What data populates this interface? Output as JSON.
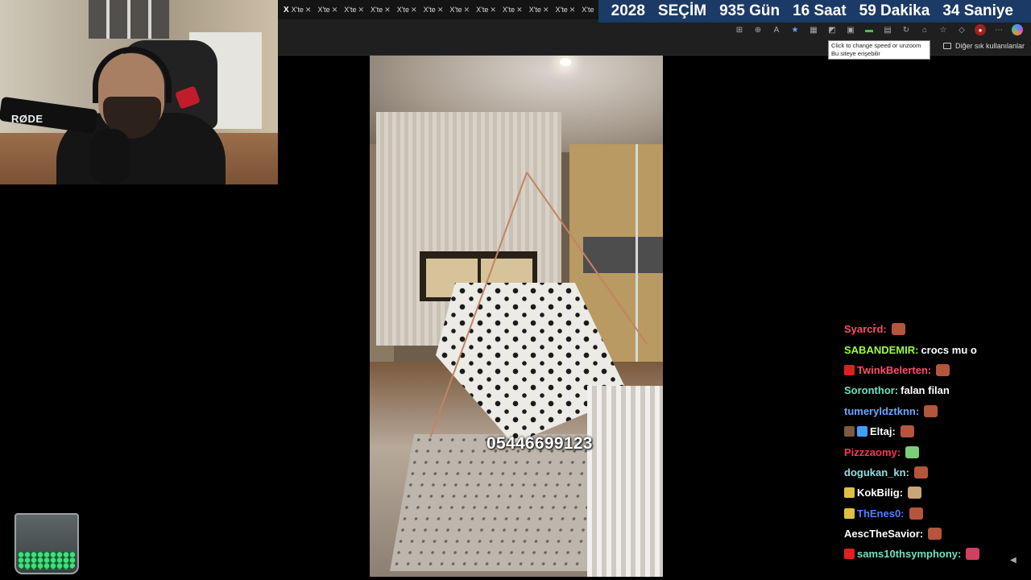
{
  "tabs": [
    {
      "label": "X'te"
    },
    {
      "label": "X'te"
    },
    {
      "label": "X'te"
    },
    {
      "label": "X'te"
    },
    {
      "label": "X'te"
    },
    {
      "label": "X'te"
    },
    {
      "label": "X'te"
    },
    {
      "label": "X'te"
    },
    {
      "label": "X'te"
    },
    {
      "label": "X'te"
    },
    {
      "label": "X'te"
    },
    {
      "label": "X'te"
    }
  ],
  "countdown": {
    "year": "2028",
    "label": "SEÇİM",
    "days": "935 Gün",
    "hours": "16 Saat",
    "minutes": "59 Dakika",
    "seconds": "34 Saniye",
    "bg_color": "#1c3a66"
  },
  "toolbar_icons": [
    "grid-icon",
    "zoom-icon",
    "read-aloud-icon",
    "favorite-star-icon",
    "extensions-icon",
    "speed-extension-icon",
    "screenshot-icon",
    "green-extension-icon",
    "wallet-icon",
    "refresh-icon",
    "cart-icon",
    "collections-icon",
    "shield-icon",
    "profile-avatar",
    "menu-dots-icon",
    "copilot-icon"
  ],
  "tooltip": {
    "line1": "Click to change speed or unzoom",
    "line2": "Bu siteye erişebilir"
  },
  "bookmarks": {
    "other_label": "Diğer sık kullanılanlar"
  },
  "webcam": {
    "mic_brand": "RØDE"
  },
  "video": {
    "overlay_text": "05446699123"
  },
  "chat": [
    {
      "user": "Syarcrd:",
      "color": "#ff4d6a",
      "text": "",
      "emote": "#b5553c"
    },
    {
      "user": "SABANDEMIR:",
      "color": "#9dff3a",
      "text": "crocs mu o",
      "emote": ""
    },
    {
      "user": "TwinkBelerten:",
      "color": "#ff4d6a",
      "text": "",
      "emote": "#b5553c",
      "badge": "#e02020"
    },
    {
      "user": "Soronthor:",
      "color": "#6fe2c0",
      "text": "falan filan",
      "emote": ""
    },
    {
      "user": "tumeryldztknn:",
      "color": "#6aa8ff",
      "text": "",
      "emote": "#b5553c"
    },
    {
      "user": "Eltaj:",
      "color": "#ffffff",
      "text": "",
      "emote": "#b5553c",
      "badge": "#7a5a40",
      "badge2": "#3fa0ff"
    },
    {
      "user": "Pizzzaomy:",
      "color": "#ff3355",
      "text": "",
      "emote": "#7ad07a"
    },
    {
      "user": "dogukan_kn:",
      "color": "#8fe0e0",
      "text": "",
      "emote": "#b5553c"
    },
    {
      "user": "KokBilig:",
      "color": "#ffffff",
      "text": "",
      "emote": "#c9a57a",
      "badge": "#e0c040"
    },
    {
      "user": "ThEnes0:",
      "color": "#4f7fff",
      "text": "",
      "emote": "#b5553c",
      "badge": "#e0c040"
    },
    {
      "user": "AescTheSavior:",
      "color": "#ffffff",
      "text": "",
      "emote": "#b5553c"
    },
    {
      "user": "sams10thsymphony:",
      "color": "#6fe2c0",
      "text": "",
      "emote": "#d04060",
      "badge": "#e02020"
    }
  ]
}
